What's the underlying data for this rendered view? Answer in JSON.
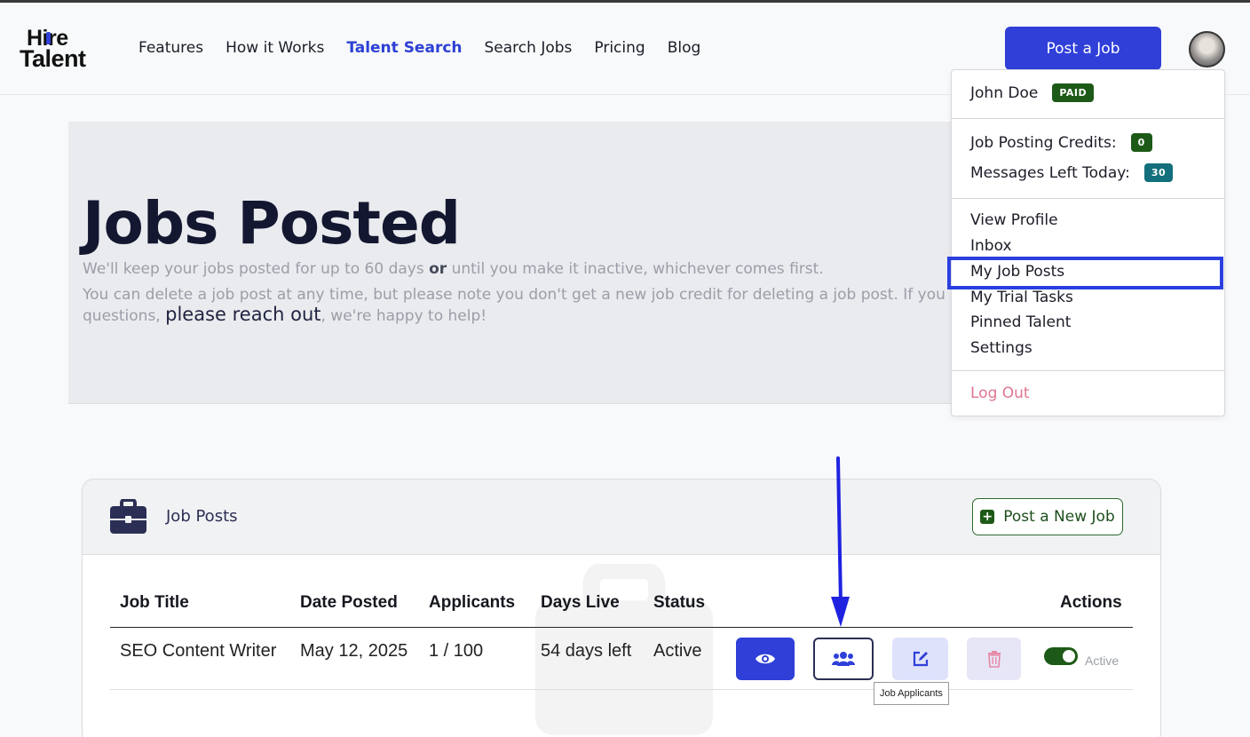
{
  "brand": {
    "logo_line1": "Hire",
    "logo_line2": "Talent"
  },
  "nav": {
    "links": [
      "Features",
      "How it Works",
      "Talent Search",
      "Search Jobs",
      "Pricing",
      "Blog"
    ],
    "active": "Talent Search",
    "post_job_label": "Post a Job"
  },
  "hero": {
    "title": "Jobs Posted",
    "p1_start": "We'll keep your jobs posted for up to 60 days ",
    "p1_bold": "or",
    "p1_end": " until you make it inactive, whichever comes first.",
    "p2": "You can delete a job post at any time, but please note you don't get a new job credit for deleting a job post. If you have any",
    "p3_start": "questions, ",
    "p3_link": "please reach out",
    "p3_end": ", we're happy to help!"
  },
  "dropdown": {
    "user_name": "John Doe",
    "plan_badge": "PAID",
    "credits_label": "Job Posting Credits:",
    "credits_value": "0",
    "messages_label": "Messages Left Today:",
    "messages_value": "30",
    "items": [
      "View Profile",
      "Inbox",
      "My Job Posts",
      "My Trial Tasks",
      "Pinned Talent",
      "Settings"
    ],
    "highlighted": "My Job Posts",
    "logout": "Log Out"
  },
  "card": {
    "title": "Job Posts",
    "new_job_label": "Post a New Job",
    "columns": [
      "Job Title",
      "Date Posted",
      "Applicants",
      "Days Live",
      "Status",
      "Actions"
    ],
    "rows": [
      {
        "title": "SEO Content Writer",
        "date": "May 12, 2025",
        "applicants": "1 / 100",
        "days": "54 days left",
        "status": "Active",
        "toggle_label": "Active",
        "toggle_on": true
      }
    ]
  },
  "tooltip": "Job Applicants",
  "colors": {
    "primary": "#2f3fd8",
    "success": "#1d5a17",
    "teal": "#136f7b",
    "logout": "#e07590",
    "annotation": "#2b3fe0"
  }
}
